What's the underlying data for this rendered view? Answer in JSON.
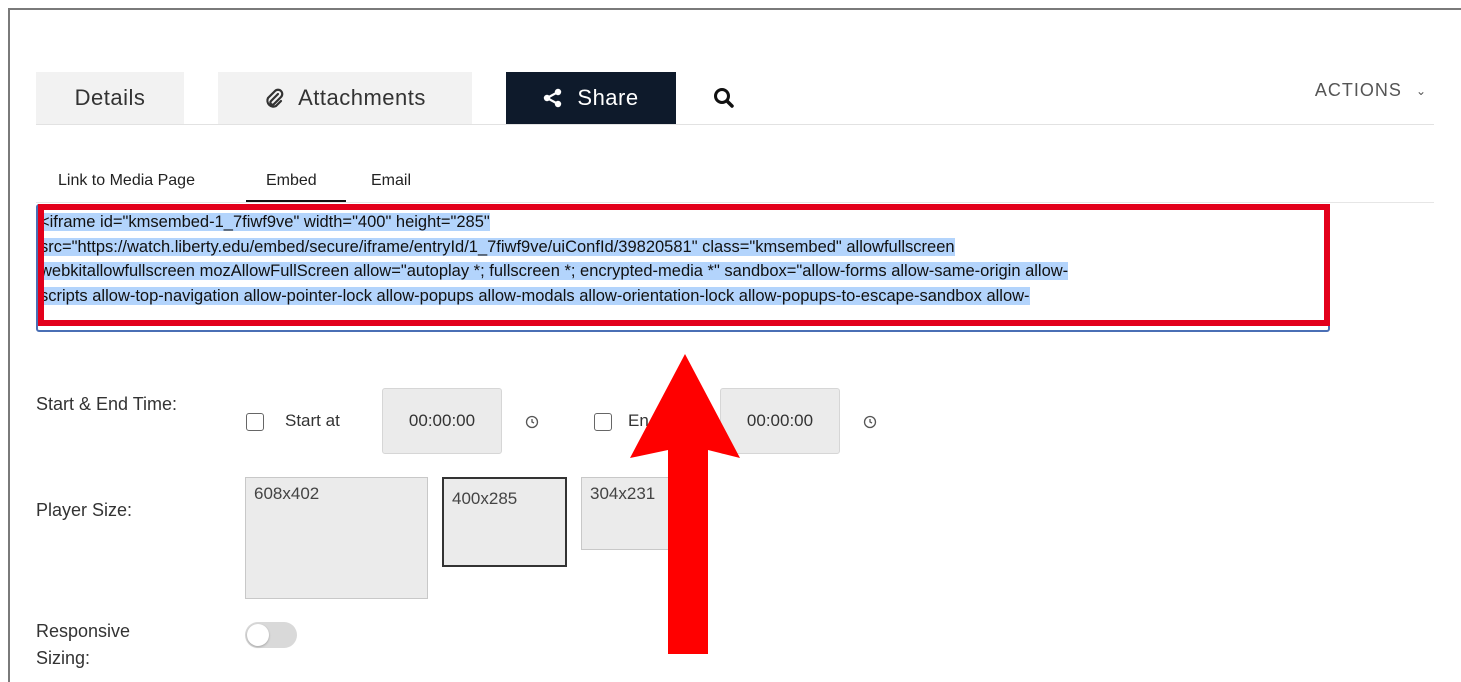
{
  "tabs": {
    "details": "Details",
    "attachments": "Attachments",
    "share": "Share",
    "attachments_icon": "paperclip-icon",
    "share_icon": "share-icon",
    "search_icon": "search-icon"
  },
  "actions": {
    "label": "ACTIONS",
    "icon": "chevron-down-icon"
  },
  "subtabs": {
    "items": [
      "Link to Media Page",
      "Embed",
      "Email"
    ],
    "active": "Embed"
  },
  "embed_code": {
    "lines": [
      "<iframe id=\"kmsembed-1_7fiwf9ve\" width=\"400\" height=\"285\"",
      "src=\"https://watch.liberty.edu/embed/secure/iframe/entryId/1_7fiwf9ve/uiConfId/39820581\" class=\"kmsembed\" allowfullscreen",
      "webkitallowfullscreen mozAllowFullScreen allow=\"autoplay *; fullscreen *; encrypted-media *\" sandbox=\"allow-forms allow-same-origin allow-",
      "scripts allow-top-navigation allow-pointer-lock allow-popups allow-modals allow-orientation-lock allow-popups-to-escape-sandbox allow-"
    ],
    "selected": true
  },
  "start_end": {
    "label": "Start & End Time:",
    "start_label": "Start at",
    "start_value": "00:00:00",
    "start_checked": false,
    "end_label": "En",
    "end_value": "00:00:00",
    "end_checked": false,
    "clock_icon": "clock-icon"
  },
  "player_size": {
    "label": "Player Size:",
    "options": [
      "608x402",
      "400x285",
      "304x231"
    ],
    "selected": "400x285"
  },
  "responsive": {
    "label": "Responsive Sizing:",
    "enabled": false
  },
  "annotation": {
    "highlight_color": "#e3001b",
    "arrow_color": "#ff0000",
    "arrow_direction": "up"
  },
  "colors": {
    "share_tab_bg": "#0e1a2b",
    "selection": "#b3d4fc"
  }
}
